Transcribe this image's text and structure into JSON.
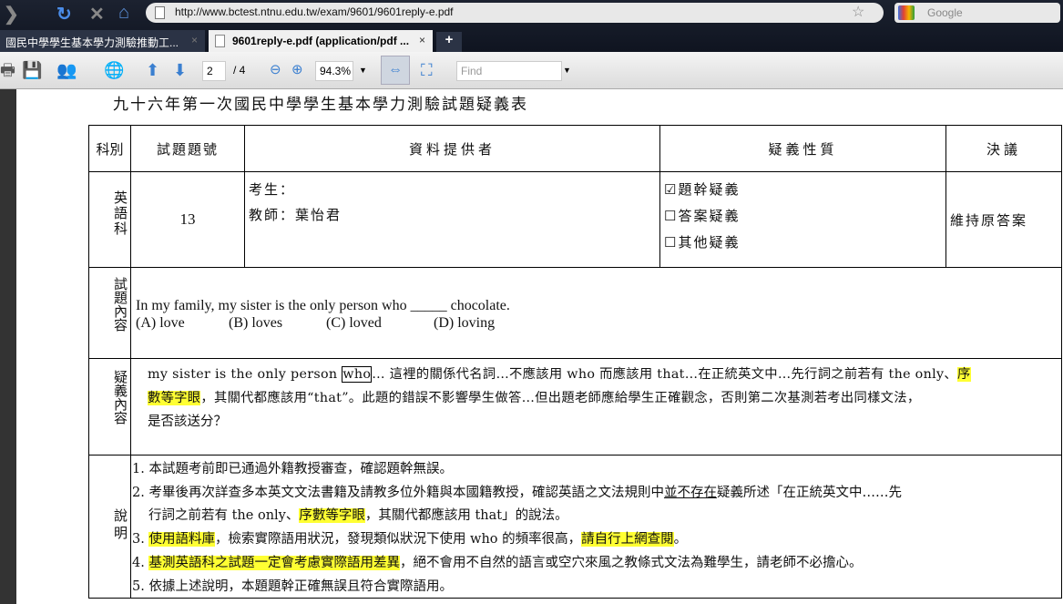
{
  "browser": {
    "url": "http://www.bctest.ntnu.edu.tw/exam/9601/9601reply-e.pdf",
    "search_placeholder": "Google",
    "tabs": [
      {
        "label": "國民中學學生基本學力測驗推動工..."
      },
      {
        "label": "9601reply-e.pdf (application/pdf ..."
      }
    ],
    "new_tab": "+",
    "close": "×"
  },
  "pdf_toolbar": {
    "page": "2",
    "page_total": "/ 4",
    "zoom": "94.3%",
    "find_placeholder": "Find"
  },
  "doc": {
    "title": "九十六年第一次國民中學學生基本學力測驗試題疑義表",
    "headers": [
      "科別",
      "試題題號",
      "資料提供者",
      "疑義性質",
      "決議"
    ],
    "subject": "英語科",
    "question_no": "13",
    "provider_student": "考生：",
    "provider_teacher": "教師：葉怡君",
    "nature": [
      "☑題幹疑義",
      "☐答案疑義",
      "☐其他疑義"
    ],
    "decision": "維持原答案",
    "content_label": "試題內容",
    "question": "In my family, my sister is the only person who _____ chocolate.",
    "options": [
      "(A) love",
      "(B) loves",
      "(C) loved",
      "(D) loving"
    ],
    "doubt_label": "疑義內容",
    "doubt": {
      "p1": "my sister is the only person ",
      "who": "who",
      "p2": "…  這裡的關係代名詞…不應該用 who 而應該用 that…在正統英文中…先行詞之前若有 the only、",
      "h1a": "序",
      "h1b": "數等字眼",
      "p3": "，其關代都應該用“that”。此題的錯誤不影響學生做答…但出題老師應給學生正確觀念，否則第二次基測若考出同樣文法，",
      "p4": "是否該送分？"
    },
    "explain_label": "說明",
    "explain": {
      "l1": "1.  本試題考前即已通過外籍教授審查，確認題幹無誤。",
      "l2a": "2.  考畢後再次詳查多本英文文法書籍及請教多位外籍與本國籍教授，確認英語之文法規則中",
      "l2u": "並不存在",
      "l2b": "疑義所述「在正統英文中……先",
      "l2c": "行詞之前若有 the only、",
      "l2h": "序數等字眼",
      "l2d": "，其關代都應該用 that」的說法。",
      "l3a": "3.  ",
      "l3h": "使用語料庫",
      "l3b": "，檢索實際語用狀況，發現類似狀況下使用 who 的頻率很高，",
      "l3h2": "請自行上網查閱",
      "l3c": "。",
      "l4a": "4.  ",
      "l4h": "基測英語科之試題一定會考慮實際語用差異",
      "l4b": "，絕不會用不自然的語言或空穴來風之教條式文法為難學生，請老師不必擔心。",
      "l5": "5.  依據上述說明，本題題幹正確無誤且符合實際語用。"
    }
  }
}
